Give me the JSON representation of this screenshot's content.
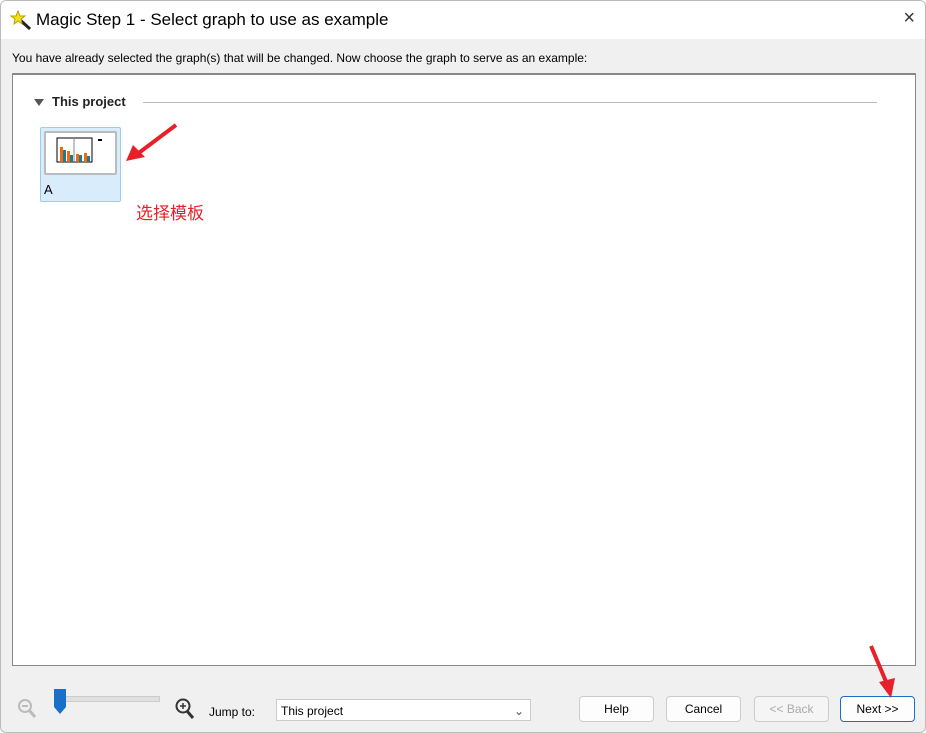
{
  "window": {
    "title": "Magic Step 1 - Select graph to use as example",
    "close_icon": "×"
  },
  "instruction": "You have already selected the graph(s) that will be changed. Now choose the graph to serve as an example:",
  "section": {
    "title": "This project",
    "items": [
      {
        "label": "A"
      }
    ]
  },
  "annotation": "选择模板",
  "footer": {
    "jump_label": "Jump to:",
    "jump_value": "This project",
    "zoom_level_percent": 0,
    "help": "Help",
    "cancel": "Cancel",
    "back": "<< Back",
    "next": "Next >>"
  },
  "colors": {
    "annotation": "#e8202a",
    "slider": "#1a6fc9"
  }
}
